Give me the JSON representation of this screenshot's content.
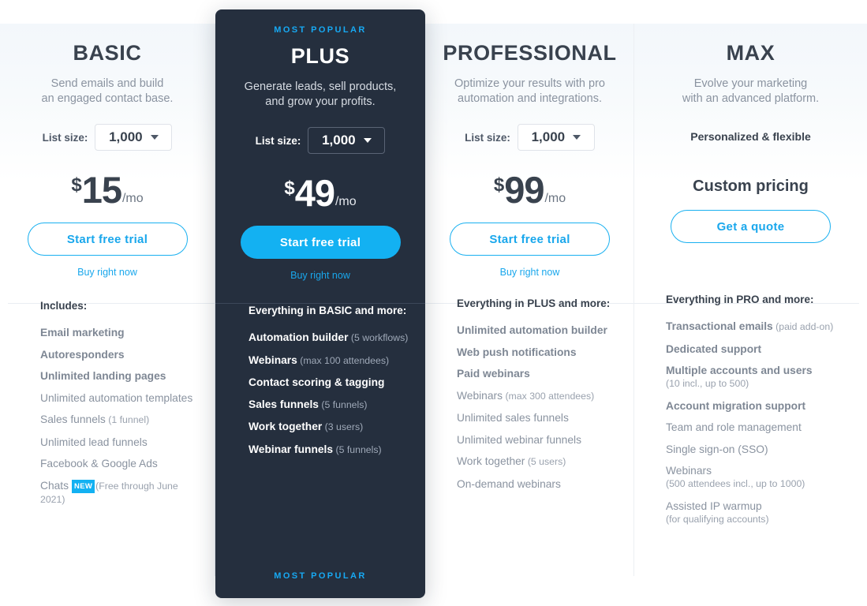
{
  "layout": {
    "accent_color": "#13b1f2",
    "dark_card_color": "#252f3e",
    "heading_color": "#39424e",
    "muted_color": "#8a93a0"
  },
  "plans": {
    "basic": {
      "name": "BASIC",
      "desc_line1": "Send emails and build",
      "desc_line2": "an engaged contact base.",
      "list_size_label": "List size:",
      "list_size_value": "1,000",
      "currency": "$",
      "amount": "15",
      "period": "/mo",
      "cta": "Start free trial",
      "secondary_cta": "Buy right now",
      "features_head": "Includes:",
      "features": [
        {
          "text": "Email marketing",
          "strong": true
        },
        {
          "text": "Autoresponders",
          "strong": true
        },
        {
          "text": "Unlimited landing pages",
          "strong": true
        },
        {
          "text": "Unlimited automation templates",
          "strong": false
        },
        {
          "text": "Sales funnels",
          "note": "(1 funnel)",
          "strong": false
        },
        {
          "text": "Unlimited lead funnels",
          "strong": false
        },
        {
          "text": "Facebook & Google Ads",
          "strong": false
        },
        {
          "text": "Chats",
          "badge": "NEW",
          "note": "(Free through June 2021)",
          "strong": false
        }
      ]
    },
    "plus": {
      "ribbon_top": "MOST POPULAR",
      "ribbon_bottom": "MOST POPULAR",
      "name": "PLUS",
      "desc_line1": "Generate leads, sell products,",
      "desc_line2": "and grow your profits.",
      "list_size_label": "List size:",
      "list_size_value": "1,000",
      "currency": "$",
      "amount": "49",
      "period": "/mo",
      "cta": "Start free trial",
      "secondary_cta": "Buy right now",
      "features_head": "Everything in BASIC and more:",
      "features": [
        {
          "text": "Automation builder",
          "note": "(5 workflows)",
          "strong": true
        },
        {
          "text": "Webinars",
          "note": "(max 100 attendees)",
          "strong": true
        },
        {
          "text": "Contact scoring & tagging",
          "strong": true
        },
        {
          "text": "Sales funnels",
          "note": "(5 funnels)",
          "strong": true
        },
        {
          "text": "Work together",
          "note": "(3 users)",
          "strong": true
        },
        {
          "text": "Webinar funnels",
          "note": "(5 funnels)",
          "strong": true
        }
      ]
    },
    "professional": {
      "name": "PROFESSIONAL",
      "desc_line1": "Optimize your results with pro",
      "desc_line2": "automation and integrations.",
      "list_size_label": "List size:",
      "list_size_value": "1,000",
      "currency": "$",
      "amount": "99",
      "period": "/mo",
      "cta": "Start free trial",
      "secondary_cta": "Buy right now",
      "features_head": "Everything in PLUS and more:",
      "features": [
        {
          "text": "Unlimited automation builder",
          "strong": true
        },
        {
          "text": "Web push notifications",
          "strong": true
        },
        {
          "text": "Paid webinars",
          "strong": true
        },
        {
          "text": "Webinars",
          "note": "(max 300 attendees)",
          "strong": false
        },
        {
          "text": "Unlimited sales funnels",
          "strong": false
        },
        {
          "text": "Unlimited webinar funnels",
          "strong": false
        },
        {
          "text": "Work together",
          "note": "(5 users)",
          "strong": false
        },
        {
          "text": "On-demand webinars",
          "strong": false
        }
      ]
    },
    "max": {
      "name": "MAX",
      "desc_line1": "Evolve your marketing",
      "desc_line2": "with an advanced platform.",
      "personalized": "Personalized & flexible",
      "custom_pricing": "Custom pricing",
      "cta": "Get a quote",
      "features_head": "Everything in PRO and more:",
      "features": [
        {
          "text": "Transactional emails",
          "note": "(paid add-on)",
          "strong": true
        },
        {
          "text": "Dedicated support",
          "strong": true
        },
        {
          "text": "Multiple accounts and users",
          "sub": "(10 incl., up to 500)",
          "strong": true
        },
        {
          "text": "Account migration support",
          "strong": true
        },
        {
          "text": "Team and role management",
          "strong": false
        },
        {
          "text": "Single sign-on (SSO)",
          "strong": false
        },
        {
          "text": "Webinars",
          "sub": "(500 attendees incl., up to 1000)",
          "strong": false
        },
        {
          "text": "Assisted IP warmup",
          "sub": "(for qualifying accounts)",
          "strong": false
        }
      ]
    }
  }
}
